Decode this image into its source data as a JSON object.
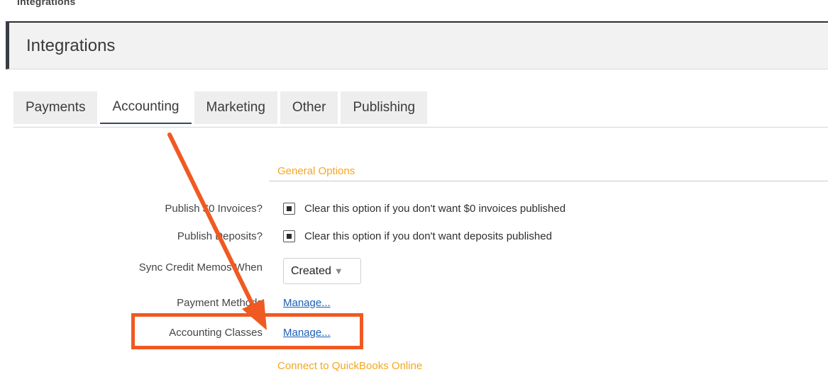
{
  "breadcrumb": "Integrations",
  "header": {
    "title": "Integrations"
  },
  "tabs": [
    {
      "label": "Payments",
      "active": false
    },
    {
      "label": "Accounting",
      "active": true
    },
    {
      "label": "Marketing",
      "active": false
    },
    {
      "label": "Other",
      "active": false
    },
    {
      "label": "Publishing",
      "active": false
    }
  ],
  "general_options": {
    "title": "General Options",
    "rows": {
      "publish_zero_invoices": {
        "label": "Publish $0 Invoices?",
        "checked": true,
        "help": "Clear this option if you don't want $0 invoices published"
      },
      "publish_deposits": {
        "label": "Publish Deposits?",
        "checked": true,
        "help": "Clear this option if you don't want deposits published"
      },
      "sync_credit_memos": {
        "label": "Sync Credit Memos When",
        "value": "Created"
      },
      "payment_methods": {
        "label": "Payment Methods",
        "link": "Manage..."
      },
      "accounting_classes": {
        "label": "Accounting Classes",
        "link": "Manage..."
      }
    }
  },
  "connect_section": {
    "title": "Connect to QuickBooks Online"
  },
  "colors": {
    "accent": "#f5a623",
    "annotation": "#f05a22",
    "link": "#1a5fb4"
  }
}
